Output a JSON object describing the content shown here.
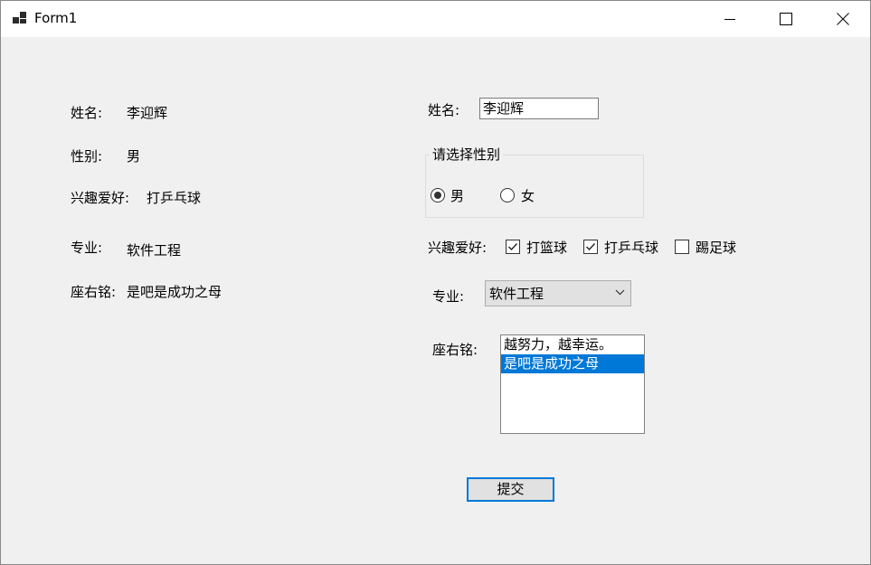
{
  "window": {
    "title": "Form1"
  },
  "left_panel": {
    "name_label": "姓名:",
    "name_value": "李迎辉",
    "gender_label": "性别:",
    "gender_value": "男",
    "hobby_label": "兴趣爱好:",
    "hobby_value": "打乒乓球",
    "major_label": "专业:",
    "major_value": "软件工程",
    "motto_label": "座右铭:",
    "motto_value": "是吧是成功之母"
  },
  "form": {
    "name_label": "姓名:",
    "name_input_value": "李迎辉",
    "gender_group_title": "请选择性别",
    "gender_options": [
      {
        "label": "男",
        "checked": true
      },
      {
        "label": "女",
        "checked": false
      }
    ],
    "hobby_label": "兴趣爱好:",
    "hobbies": [
      {
        "label": "打篮球",
        "checked": true
      },
      {
        "label": "打乒乓球",
        "checked": true
      },
      {
        "label": "踢足球",
        "checked": false
      }
    ],
    "major_label": "专业:",
    "major_selected": "软件工程",
    "motto_label": "座右铭:",
    "motto_options": [
      {
        "label": "越努力，越幸运。",
        "selected": false
      },
      {
        "label": "是吧是成功之母",
        "selected": true
      }
    ],
    "submit_label": "提交"
  },
  "icons": {
    "app": "app-icon",
    "minimize": "minimize-icon",
    "maximize": "maximize-icon",
    "close": "close-icon",
    "dropdown": "chevron-down-icon"
  },
  "colors": {
    "selection": "#0078d7",
    "button_border": "#0078d7",
    "form_background": "#f0f0f0"
  }
}
